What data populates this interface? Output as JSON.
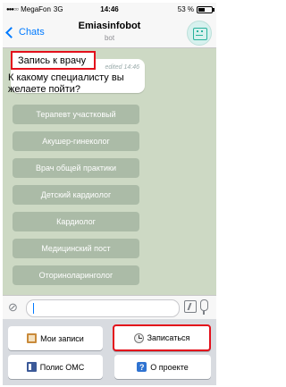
{
  "status": {
    "carrier": "MegaFon",
    "network": "3G",
    "time": "14:46",
    "battery": "53 %",
    "battery_level": 0.53
  },
  "nav": {
    "back_label": "Chats",
    "title": "Emiasinfobot",
    "subtitle": "bot",
    "avatar_icon": "bot-face-icon"
  },
  "messages": [
    {
      "text": "Запись к врачу",
      "meta": "edited 14:46"
    },
    {
      "text": "К какому специалисту вы желаете пойти?"
    }
  ],
  "inline_buttons": [
    "Терапевт участковый",
    "Акушер-гинеколог",
    "Врач общей практики",
    "Детский кардиолог",
    "Кардиолог",
    "Медицинский пост",
    "Оториноларинголог"
  ],
  "input": {
    "placeholder": ""
  },
  "keyboard": [
    {
      "label": "Мои записи",
      "icon": "notebook-icon"
    },
    {
      "label": "Записаться",
      "icon": "clock-icon"
    },
    {
      "label": "Полис ОМС",
      "icon": "id-card-icon"
    },
    {
      "label": "О проекте",
      "icon": "question-icon"
    }
  ],
  "colors": {
    "accent": "#007aff",
    "highlight": "#e3101b",
    "chat_bg": "#cdd9c4"
  }
}
